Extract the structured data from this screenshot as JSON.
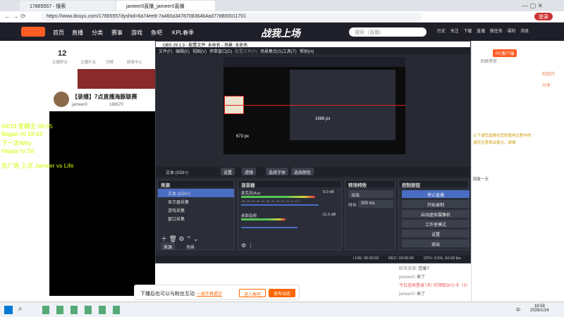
{
  "browser": {
    "tabs": [
      {
        "title": "17865557 - 搜索"
      },
      {
        "title": "jameer0直播_jameer0直播"
      }
    ],
    "url": "https://www.douyu.com/17865557dyshid=6a74ee8-7a460a3478708364b4ad77d800011701",
    "toolbar": {
      "login_label": "登录"
    }
  },
  "site": {
    "nav": [
      "首页",
      "直播",
      "分类",
      "赛事",
      "游戏",
      "鱼吧",
      "KPL春季"
    ],
    "banner": "战我上场",
    "search_placeholder": "搜索（直播）",
    "header_right": [
      "历史",
      "关注",
      "下载",
      "直播",
      "做任务",
      "福利",
      "消息"
    ],
    "sub": {
      "level": "12",
      "level_label": "主播积分",
      "b1": "主播开关",
      "b2": "月榜",
      "b3": "勋章中心",
      "b4": "粉丝"
    },
    "title": "【录播】7点直播海豚联赛",
    "room_no": "166557",
    "streamer": "jameer0",
    "hot": "186570",
    "follow": "暂停斗豆"
  },
  "overlay_text": [
    "04/13 星期五 09:05",
    "Began At 18:43",
    "下一次Who",
    "Happy to Sit",
    "在广告 上次 Jameer vs Life"
  ],
  "right_panel": {
    "pc_badge": "PC客户端",
    "link": "贡献榜单",
    "badge2": "粘团内",
    "items": [
      "分享",
      "打赏"
    ],
    "notice1": "以下请您选择在您的使用过程中的",
    "notice2": "请您注意相关提示，谢谢",
    "reply": "回复一天"
  },
  "obs": {
    "title": "OBS 29.1.3 - 配置文件: 未命名 - 场景: 未命名",
    "menu": [
      "文件(F)",
      "编辑(E)",
      "视图(V)",
      "停靠窗口(D)",
      "配置文件(P)",
      "场景集合(S)",
      "工具(T)",
      "帮助(H)"
    ],
    "preview_label": "1688 px",
    "preview_label2": "673 px",
    "source_bar": {
      "source": "文本 (GDI+)",
      "settings": "设置",
      "filters": "滤镜",
      "font": "选择字体",
      "color": "选择颜色"
    },
    "scenes_head": "来源",
    "sources": [
      "文本 (GDI+)",
      "显示器采集",
      "游戏采集",
      "窗口采集"
    ],
    "mixer_head": "混音器",
    "mixer": [
      {
        "name": "麦克风/Aux",
        "db": "0.0 dB",
        "level": 0.75
      },
      {
        "name": "桌面音频",
        "db": "-11.0 dB",
        "level": 0.45
      }
    ],
    "meter_ticks": "-60 -55 -50 -45 -40 -35 -30 -25 -20 -15 -10 -5 0",
    "transition_head": "转场特效",
    "transition": "淡出",
    "duration_label": "时长",
    "duration": "300 ms",
    "controls_head": "控制按钮",
    "controls": [
      "停止直播",
      "开始录制",
      "启动虚拟摄像机",
      "工作室模式",
      "设置",
      "退出"
    ],
    "tabs": [
      "来源",
      "场景"
    ],
    "status": {
      "live": "LIVE: 00:00:00",
      "rec": "REC: 00:00:00",
      "cpu": "CPU: 0.5%, 60.00 fps"
    }
  },
  "chat": [
    {
      "user": "听风流浪",
      "text": "您爱?"
    },
    {
      "user": "jameer0",
      "text": "来了"
    },
    {
      "user": "",
      "text": "今日连续登录7天! 可领取30小卡（3）"
    },
    {
      "user": "jameer0",
      "text": "来了"
    }
  ],
  "promo": {
    "text": "下播后也可以与粉丝互动",
    "link": "一周不再提示",
    "btn1": "进入鱼吧",
    "btn2": "发布动态"
  },
  "taskbar": {
    "time": "18:58",
    "date": "2026/1/24",
    "lang": "中"
  }
}
